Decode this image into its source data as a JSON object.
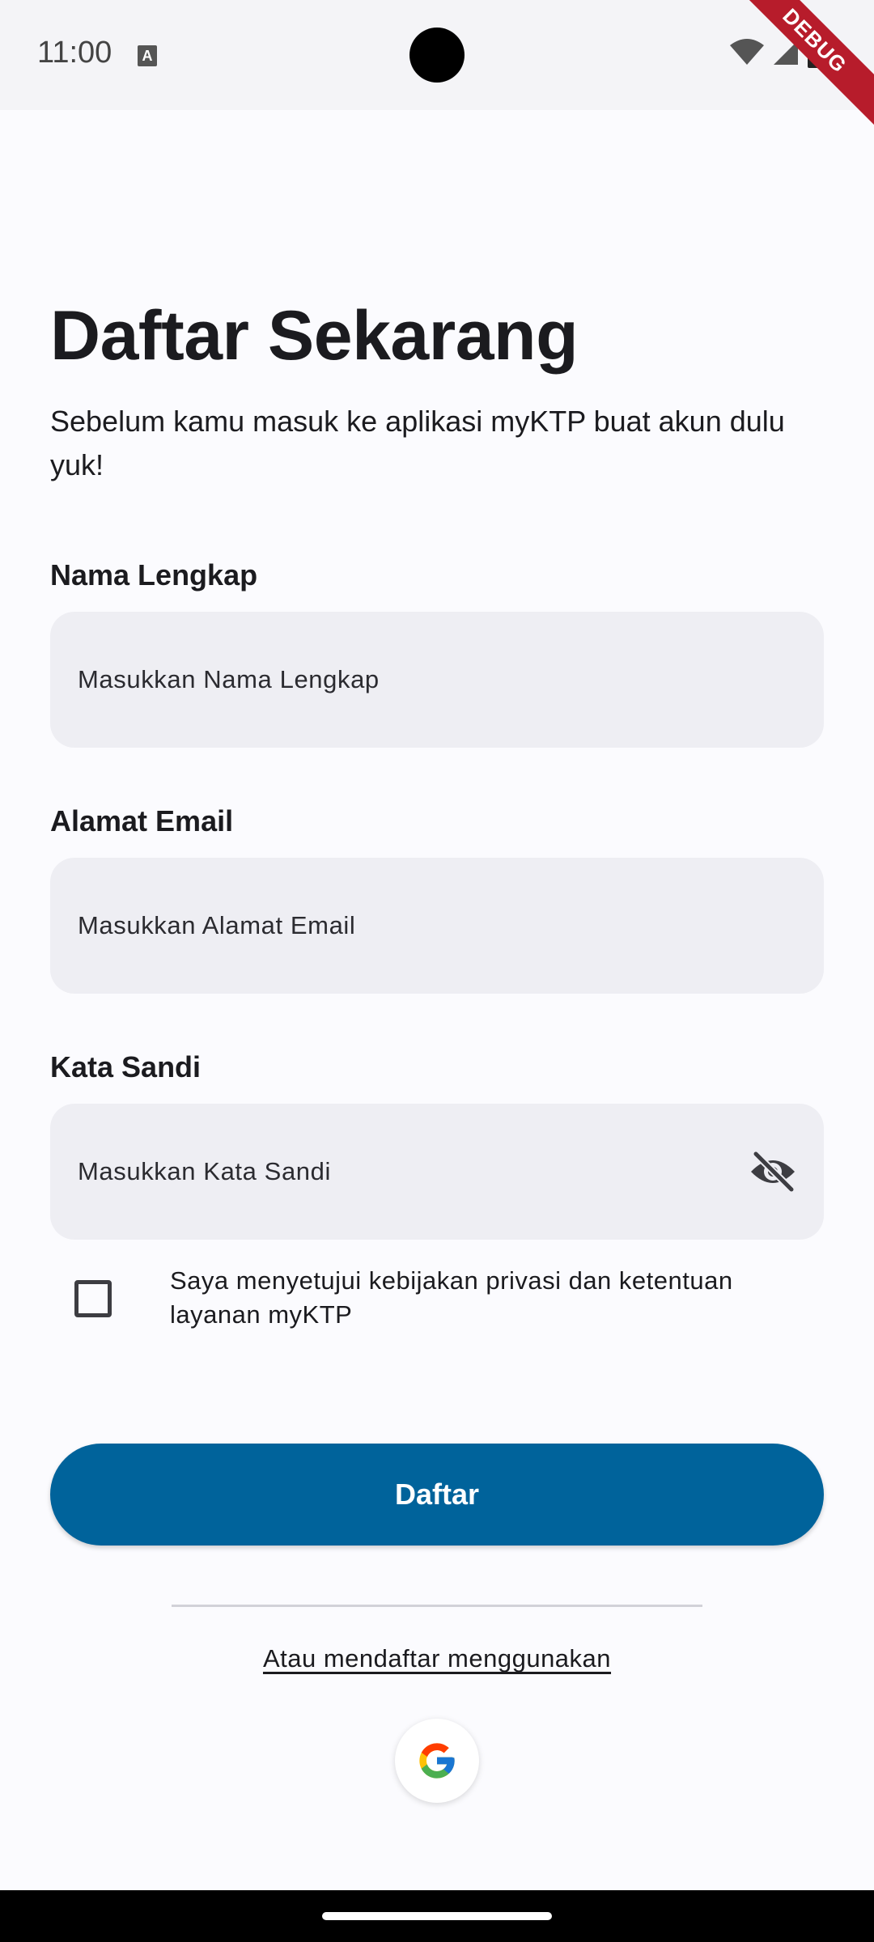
{
  "status_bar": {
    "time": "11:00",
    "a_indicator": "A",
    "debug_label": "DEBUG",
    "icons": [
      "wifi-icon",
      "signal-icon",
      "battery-icon"
    ]
  },
  "page": {
    "title": "Daftar Sekarang",
    "subtitle": "Sebelum kamu masuk ke aplikasi myKTP buat akun dulu yuk!"
  },
  "form": {
    "name": {
      "label": "Nama Lengkap",
      "placeholder": "Masukkan Nama Lengkap",
      "value": ""
    },
    "email": {
      "label": "Alamat Email",
      "placeholder": "Masukkan Alamat Email",
      "value": ""
    },
    "password": {
      "label": "Kata Sandi",
      "placeholder": "Masukkan Kata Sandi",
      "value": "",
      "toggle_icon": "eye-off-icon"
    },
    "agreement": {
      "label": "Saya menyetujui kebijakan privasi dan ketentuan layanan myKTP",
      "checked": false
    },
    "submit_label": "Daftar"
  },
  "alternative": {
    "text": "Atau mendaftar menggunakan",
    "provider_icon": "google-icon"
  },
  "colors": {
    "primary": "#00639b",
    "background": "#fbfbfe",
    "field_bg": "#eeeef3",
    "debug_banner": "#b71c2b"
  }
}
